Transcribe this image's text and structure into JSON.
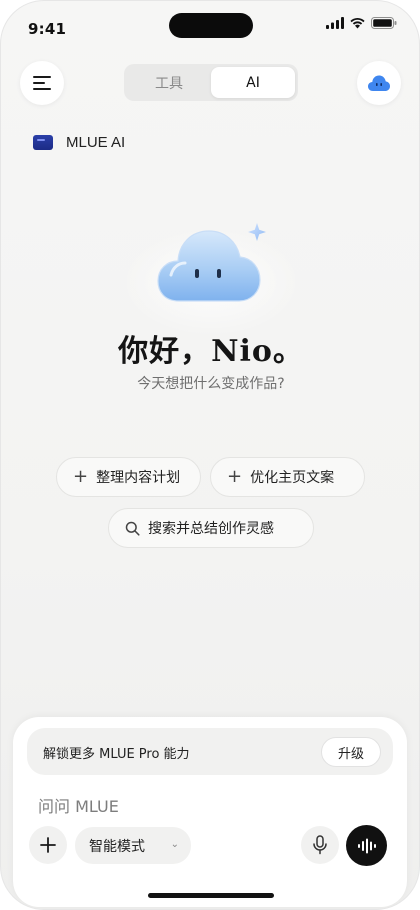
{
  "status_bar": {
    "time": "9:41"
  },
  "nav": {
    "menu_icon": "hamburger-menu-icon",
    "avatar_icon": "cloud-face-icon",
    "tabs": [
      {
        "label": "工具",
        "active": false
      },
      {
        "label": "AI",
        "active": true
      }
    ]
  },
  "brand": {
    "name": "MLUE AI"
  },
  "hero": {
    "greeting": "你好，Nio。",
    "subtitle": "今天想把什么变成作品?"
  },
  "suggestions": [
    {
      "icon": "plus-icon",
      "label": "整理内容计划"
    },
    {
      "icon": "plus-icon",
      "label": "优化主页文案"
    },
    {
      "icon": "search-icon",
      "label": "搜索并总结创作灵感"
    }
  ],
  "composer": {
    "promo_text": "解锁更多 MLUE Pro 能力",
    "upgrade_label": "升级",
    "placeholder": "问问 MLUE",
    "mode_label": "智能模式"
  },
  "colors": {
    "background": "#f3f3f2",
    "accent_blue": "#4a8ef0",
    "voice_button": "#111111"
  }
}
